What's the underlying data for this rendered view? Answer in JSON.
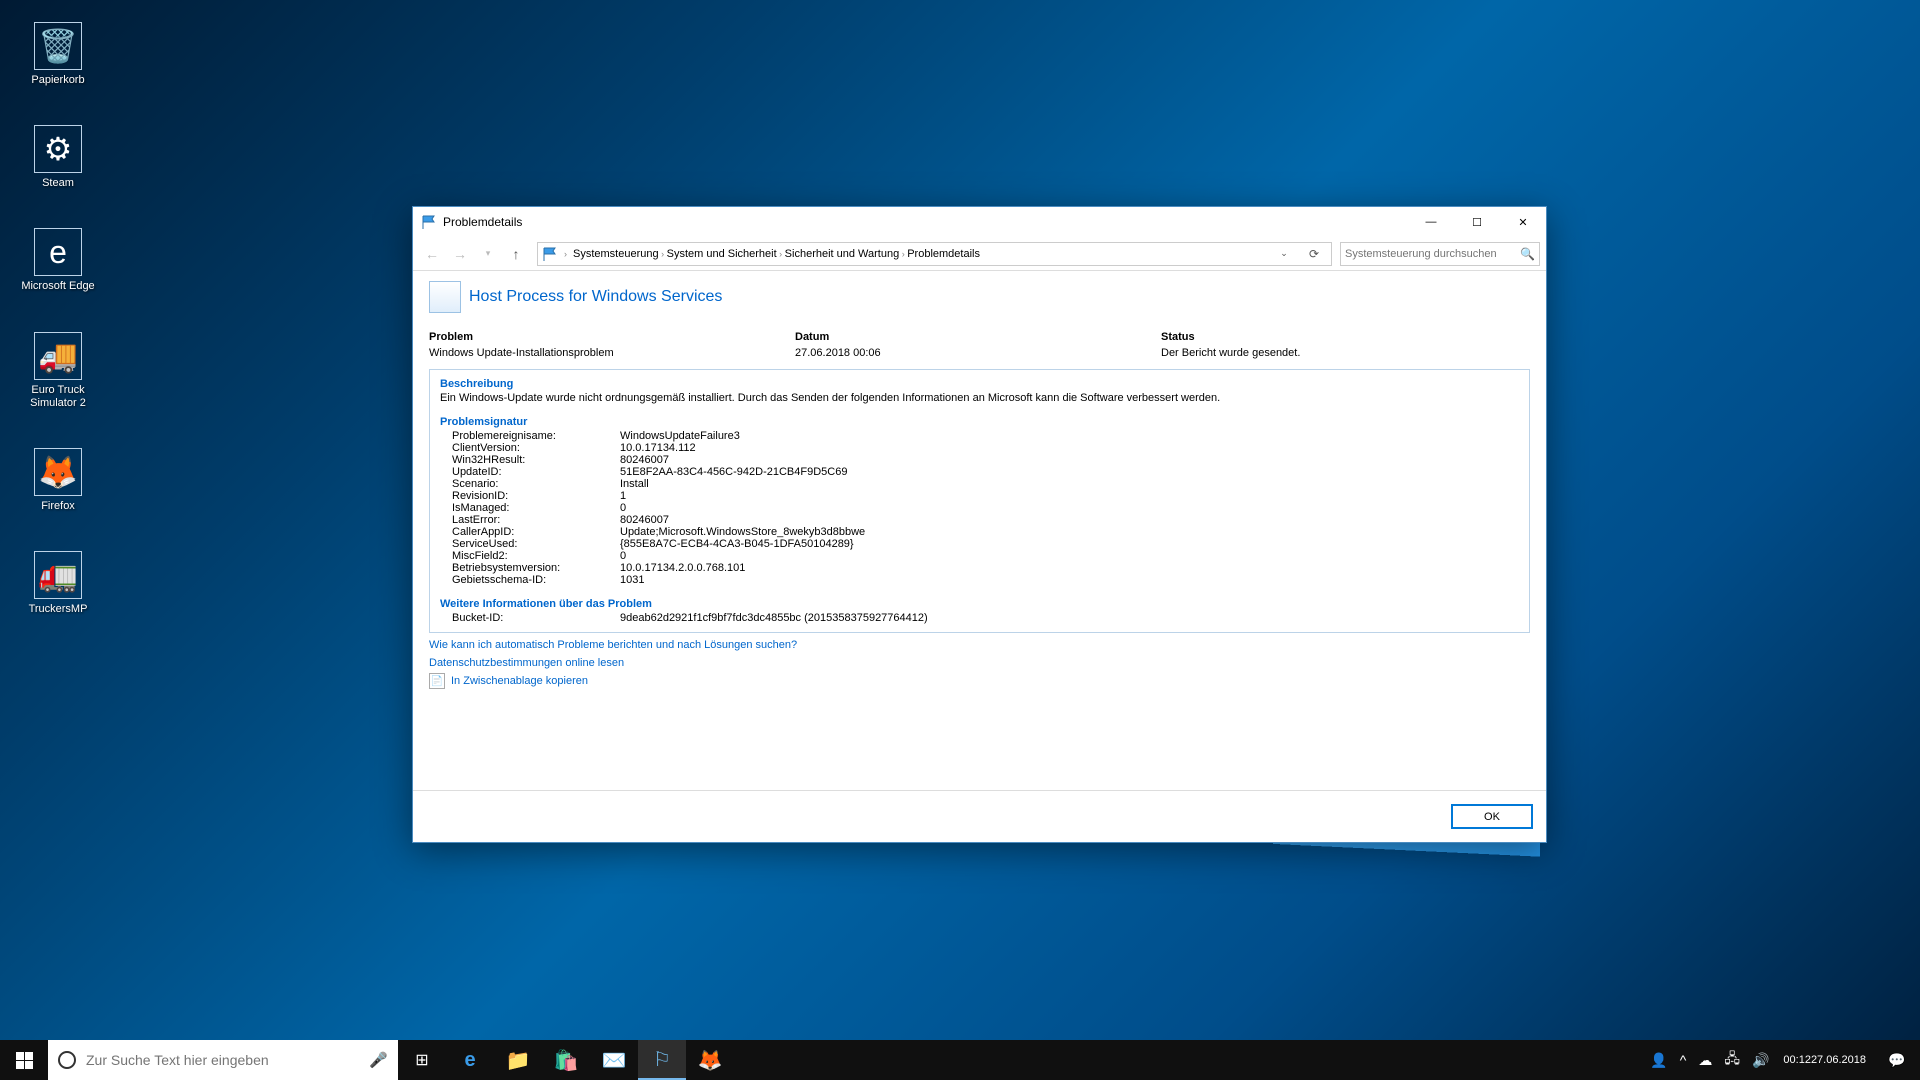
{
  "desktop_icons": [
    {
      "label": "Papierkorb",
      "glyph": "🗑️"
    },
    {
      "label": "Steam",
      "glyph": "⚙"
    },
    {
      "label": "Microsoft Edge",
      "glyph": "e"
    },
    {
      "label": "Euro Truck Simulator 2",
      "glyph": "🚚"
    },
    {
      "label": "Firefox",
      "glyph": "🦊"
    },
    {
      "label": "TruckersMP",
      "glyph": "🚛"
    }
  ],
  "window": {
    "title": "Problemdetails",
    "breadcrumb": [
      "Systemsteuerung",
      "System und Sicherheit",
      "Sicherheit und Wartung",
      "Problemdetails"
    ],
    "search_placeholder": "Systemsteuerung durchsuchen",
    "heading": "Host Process for Windows Services",
    "cols": {
      "problem": "Problem",
      "datum": "Datum",
      "status": "Status"
    },
    "vals": {
      "problem": "Windows Update-Installationsproblem",
      "datum": "27.06.2018 00:06",
      "status": "Der Bericht wurde gesendet."
    },
    "sect_beschreibung": "Beschreibung",
    "beschreibung_text": "Ein Windows-Update wurde nicht ordnungsgemäß installiert. Durch das Senden der folgenden Informationen an Microsoft kann die Software verbessert werden.",
    "sect_signatur": "Problemsignatur",
    "signatur": [
      {
        "k": "Problemereignisame:",
        "v": "WindowsUpdateFailure3"
      },
      {
        "k": "ClientVersion:",
        "v": "10.0.17134.112"
      },
      {
        "k": "Win32HResult:",
        "v": "80246007"
      },
      {
        "k": "UpdateID:",
        "v": "51E8F2AA-83C4-456C-942D-21CB4F9D5C69"
      },
      {
        "k": "Scenario:",
        "v": "Install"
      },
      {
        "k": "RevisionID:",
        "v": "1"
      },
      {
        "k": "IsManaged:",
        "v": "0"
      },
      {
        "k": "LastError:",
        "v": "80246007"
      },
      {
        "k": "CallerAppID:",
        "v": "Update;Microsoft.WindowsStore_8wekyb3d8bbwe"
      },
      {
        "k": "ServiceUsed:",
        "v": "{855E8A7C-ECB4-4CA3-B045-1DFA50104289}"
      },
      {
        "k": "MiscField2:",
        "v": "0"
      },
      {
        "k": "Betriebsystemversion:",
        "v": "10.0.17134.2.0.0.768.101"
      },
      {
        "k": "Gebietsschema-ID:",
        "v": "1031"
      }
    ],
    "sect_weitere": "Weitere Informationen über das Problem",
    "weitere": [
      {
        "k": "Bucket-ID:",
        "v": "9deab62d2921f1cf9bf7fdc3dc4855bc (2015358375927764412)"
      }
    ],
    "link1": "Wie kann ich automatisch Probleme berichten und nach Lösungen suchen?",
    "link2": "Datenschutzbestimmungen online lesen",
    "clipboard": "In Zwischenablage kopieren",
    "ok": "OK"
  },
  "taskbar": {
    "search_placeholder": "Zur Suche Text hier eingeben",
    "time": "00:12",
    "date": "27.06.2018"
  }
}
